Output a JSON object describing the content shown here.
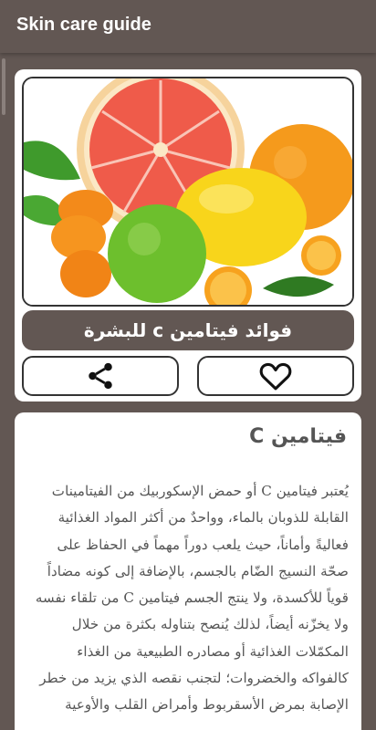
{
  "app": {
    "title": "Skin care guide"
  },
  "hero": {
    "image_label": "citrus-fruits"
  },
  "card": {
    "title": "فوائد فيتامين c للبشرة"
  },
  "actions": [
    {
      "name": "share",
      "icon": "share-icon"
    },
    {
      "name": "favorite",
      "icon": "heart-outline-icon"
    }
  ],
  "article": {
    "heading": "فيتامين C",
    "body": "يُعتبر فيتامين C أو حمض الإسكوربيك من الفيتامينات القابلة للذوبان بالماء، وواحدٌ من أكثر المواد الغذائية فعاليةً وأماناً، حيث يلعب دوراً مهماً في الحفاظ على صحّة النسيج الضّام بالجسم، بالإضافة إلى كونه مضاداً قوياً للأكسدة، ولا ينتج الجسم فيتامين C من تلقاء نفسه ولا يخزّنه أيضاً، لذلك يُنصح بتناوله بكثرة من خلال المكمّلات الغذائية أو مصادره الطبيعية من الغذاء كالفواكه والخضروات؛ لتجنب نقصه الذي يزيد من خطر الإصابة بمرض الأسقربوط وأمراض القلب والأوعية"
  },
  "colors": {
    "brand": "#625753",
    "card": "#ffffff",
    "text": "#555555"
  }
}
